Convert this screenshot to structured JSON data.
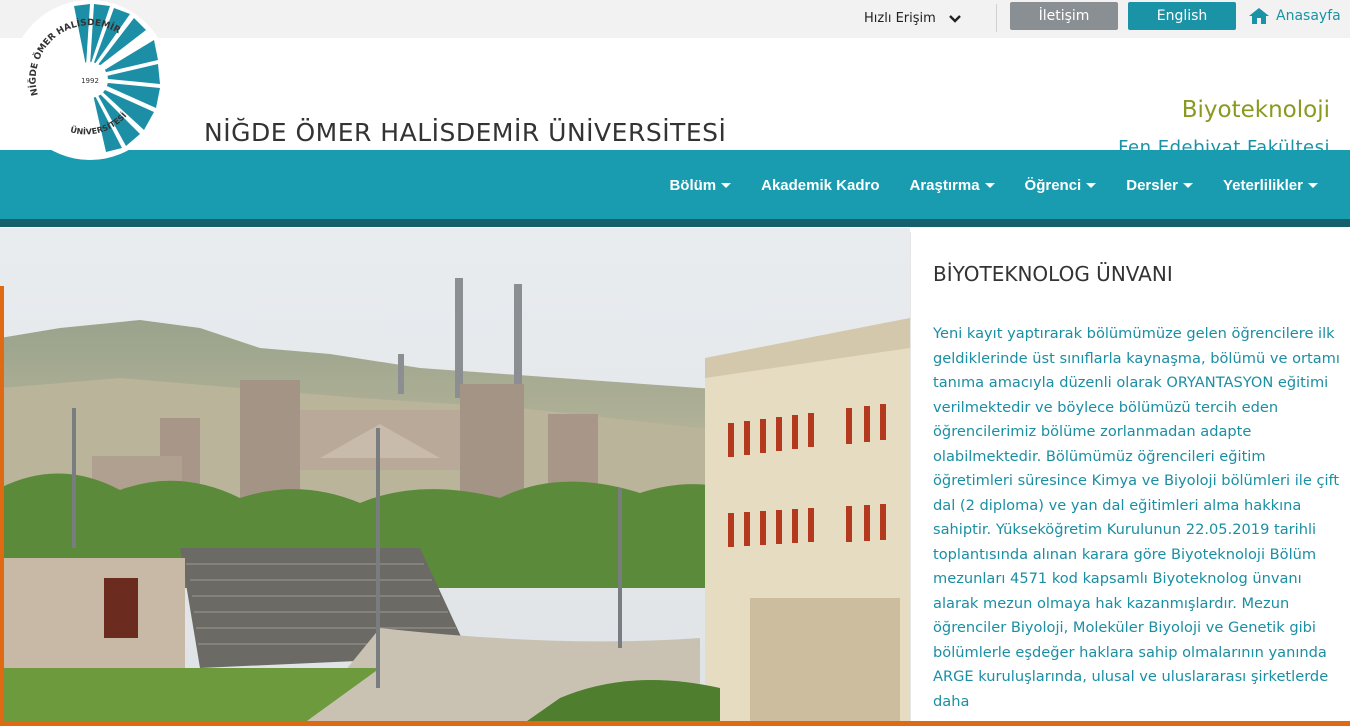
{
  "topbar": {
    "quick_access": "Hızlı Erişim",
    "contact": "İletişim",
    "language": "English",
    "home": "Anasayfa"
  },
  "header": {
    "logo_text_top": "NİĞDE ÖMER HALİSDEMİR",
    "logo_text_bottom": "ÜNİVERSİTESİ",
    "logo_year": "1992",
    "university": "NİĞDE ÖMER HALİSDEMİR ÜNİVERSİTESİ",
    "department": "Biyoteknoloji",
    "faculty": "Fen Edebiyat Fakültesi"
  },
  "nav": {
    "items": [
      {
        "label": "Bölüm",
        "dropdown": true
      },
      {
        "label": "Akademik Kadro",
        "dropdown": false
      },
      {
        "label": "Araştırma",
        "dropdown": true
      },
      {
        "label": "Öğrenci",
        "dropdown": true
      },
      {
        "label": "Dersler",
        "dropdown": true
      },
      {
        "label": "Yeterlilikler",
        "dropdown": true
      }
    ]
  },
  "panel": {
    "title": "BİYOTEKNOLOG ÜNVANI",
    "body": "Yeni kayıt yaptırarak bölümümüze gelen öğrencilere ilk geldiklerinde üst sınıflarla kaynaşma, bölümü ve ortamı tanıma amacıyla düzenli olarak ORYANTASYON eğitimi verilmektedir ve böylece bölümüzü tercih eden öğrencilerimiz bölüme zorlanmadan adapte olabilmektedir. Bölümümüz öğrencileri eğitim öğretimleri süresince Kimya ve Biyoloji bölümleri ile çift dal (2 diploma) ve yan dal eğitimleri alma hakkına sahiptir. Yükseköğretim Kurulunun 22.05.2019 tarihli toplantısında alınan karara göre Biyoteknoloji Bölüm mezunları 4571 kod kapsamlı Biyoteknolog ünvanı alarak mezun olmaya hak kazanmışlardır. Mezun öğrenciler Biyoloji, Moleküler Biyoloji ve Genetik gibi bölümlerle eşdeğer haklara sahip olmalarının yanında ARGE kuruluşlarında, ulusal ve uluslararası şirketlerde daha"
  },
  "colors": {
    "accent": "#1a9cb0",
    "accent_dark": "#16606e",
    "department_green": "#8a9a1e",
    "orange": "#e06a14"
  },
  "icons": {
    "quick_access_chevron": "chevron-down-icon",
    "home": "home-icon"
  }
}
